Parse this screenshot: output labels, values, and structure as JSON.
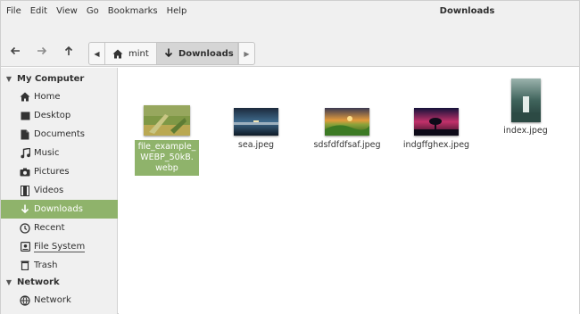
{
  "window": {
    "title": "Downloads"
  },
  "menu": [
    "File",
    "Edit",
    "View",
    "Go",
    "Bookmarks",
    "Help"
  ],
  "toolbar": {
    "back_icon": "arrow-left-icon",
    "forward_icon": "arrow-right-icon",
    "up_icon": "arrow-up-icon"
  },
  "pathbar": {
    "crumbs": [
      {
        "label": "mint",
        "icon": "home-icon",
        "active": false
      },
      {
        "label": "Downloads",
        "icon": "download-icon",
        "active": true
      }
    ]
  },
  "sidebar": {
    "sections": [
      {
        "title": "My Computer",
        "items": [
          {
            "label": "Home",
            "icon": "home-icon"
          },
          {
            "label": "Desktop",
            "icon": "desktop-icon"
          },
          {
            "label": "Documents",
            "icon": "document-icon"
          },
          {
            "label": "Music",
            "icon": "music-icon"
          },
          {
            "label": "Pictures",
            "icon": "camera-icon"
          },
          {
            "label": "Videos",
            "icon": "film-icon"
          },
          {
            "label": "Downloads",
            "icon": "download-icon",
            "selected": true
          },
          {
            "label": "Recent",
            "icon": "clock-icon"
          },
          {
            "label": "File System",
            "icon": "harddisk-icon"
          },
          {
            "label": "Trash",
            "icon": "trash-icon"
          }
        ]
      },
      {
        "title": "Network",
        "items": [
          {
            "label": "Network",
            "icon": "network-icon"
          }
        ]
      }
    ]
  },
  "files": [
    {
      "name": "file_example_WEBP_50kB.webp",
      "selected": true
    },
    {
      "name": "sea.jpeg",
      "selected": false
    },
    {
      "name": "sdsfdfdfsaf.jpeg",
      "selected": false
    },
    {
      "name": "indgffghex.jpeg",
      "selected": false
    },
    {
      "name": "index.jpeg",
      "selected": false
    }
  ],
  "colors": {
    "selection": "#8fb36b",
    "chrome": "#f0f0f0"
  }
}
